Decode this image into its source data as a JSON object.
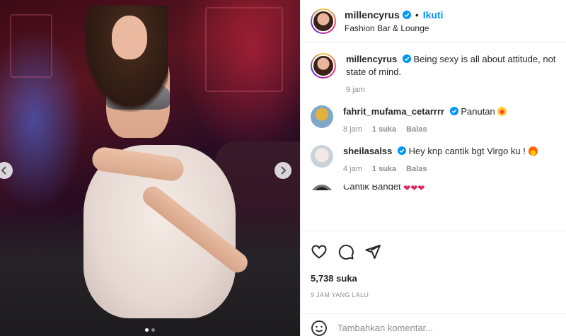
{
  "post": {
    "username": "millencyrus",
    "separator": "•",
    "follow_label": "Ikuti",
    "location": "Fashion Bar & Lounge",
    "caption": {
      "user": "millencyrus",
      "text": "Being sexy is all about attitude, not state of mind.",
      "time": "9 jam"
    },
    "comments": [
      {
        "user": "fahrit_mufama_cetarrrr",
        "text": "Panutan",
        "emoji": "star-struck-emoji",
        "time": "8 jam",
        "likes": "1 suka",
        "reply": "Balas"
      },
      {
        "user": "sheilasalss",
        "text": "Hey knp cantik bgt Virgo ku !",
        "emoji": "fire-emoji",
        "time": "4 jam",
        "likes": "1 suka",
        "reply": "Balas"
      },
      {
        "user": "",
        "text": "Cantik Banget",
        "emoji": "heart-emoji",
        "time": "",
        "likes": "",
        "reply": ""
      }
    ],
    "like_count": "5,738 suka",
    "timestamp": "9 JAM YANG LALU",
    "comment_placeholder": "Tambahkan komentar...",
    "carousel": {
      "slides": 2,
      "active": 1
    }
  },
  "colors": {
    "accent": "#0095f6",
    "verified": "#0095f6",
    "muted": "#8e8e8e",
    "text": "#262626"
  },
  "icons": [
    "chevron-left-icon",
    "chevron-right-icon",
    "verified-badge-icon",
    "heart-icon",
    "comment-icon",
    "share-icon",
    "emoji-icon"
  ]
}
